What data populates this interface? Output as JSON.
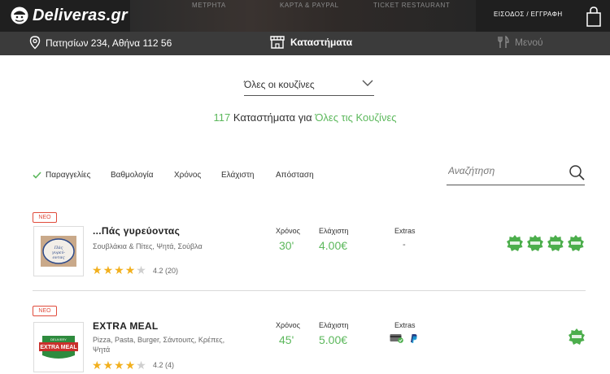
{
  "header": {
    "logo_text": "Deliveras.gr",
    "payment_tabs": [
      "ΜΕΤΡΗΤΑ",
      "ΚΑΡΤΑ & PAYPAL",
      "TICKET RESTAURANT"
    ],
    "login_label": "ΕΙΣΟΔΟΣ / ΕΓΓΡΑΦΗ"
  },
  "subnav": {
    "address": "Πατησίων 234, Αθήνα 112 56",
    "stores_label": "Καταστήματα",
    "menu_label": "Μενού"
  },
  "filter": {
    "cuisine_selected": "Όλες οι κουζίνες",
    "count": "117",
    "count_text": "Καταστήματα για",
    "cuisine_text": "Όλες τις Κουζίνες"
  },
  "sort": {
    "options": [
      "Παραγγελίες",
      "Βαθμολογία",
      "Χρόνος",
      "Ελάχιστη",
      "Απόσταση"
    ],
    "active": "Παραγγελίες"
  },
  "search": {
    "placeholder": "Αναζήτηση"
  },
  "labels": {
    "time": "Χρόνος",
    "minimum": "Ελάχιστη",
    "extras": "Extras",
    "new_badge": "ΝΕΟ"
  },
  "stores": [
    {
      "name": "...Πάς γυρεύοντας",
      "categories": "Σουβλάκια & Πίτες, Ψητά, Σούβλα",
      "rating_stars": 4,
      "rating": "4.2 (20)",
      "time": "30'",
      "minimum": "4.00€",
      "extras": "-",
      "logo_text": "Πάς γυρεύοντας",
      "promo_count": 4
    },
    {
      "name": "EXTRA MEAL",
      "categories": "Pizza, Pasta, Burger, Σάντουιτς, Κρέπες, Ψητά",
      "rating_stars": 4,
      "rating": "4.2 (4)",
      "time": "45'",
      "minimum": "5.00€",
      "extras_icons": [
        "card-payment-icon",
        "paypal-icon"
      ],
      "logo_text": "EXTRA MEAL",
      "logo_small": "DELIVERY",
      "promo_count": 1
    }
  ],
  "colors": {
    "accent_green": "#5cb85c",
    "new_red": "#e04b3b",
    "star_gold": "#f2b01e",
    "header_bg": "#1f1f1f",
    "subnav_bg": "#3b3b3b"
  }
}
